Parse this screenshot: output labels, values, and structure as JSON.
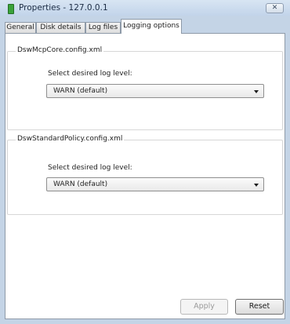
{
  "window": {
    "title": "Properties - 127.0.0.1",
    "close_glyph": "✕",
    "icon": "app-icon"
  },
  "tabs": [
    {
      "label": "General",
      "active": false
    },
    {
      "label": "Disk details",
      "active": false
    },
    {
      "label": "Log files",
      "active": false
    },
    {
      "label": "Logging options",
      "active": true
    }
  ],
  "groups": [
    {
      "title": "DswMcpCore.config.xml",
      "level_label": "Select desired log level:",
      "selected_value": "WARN (default)"
    },
    {
      "title": "DswStandardPolicy.config.xml",
      "level_label": "Select desired log level:",
      "selected_value": "WARN (default)"
    }
  ],
  "buttons": {
    "apply_label": "Apply",
    "reset_label": "Reset"
  }
}
